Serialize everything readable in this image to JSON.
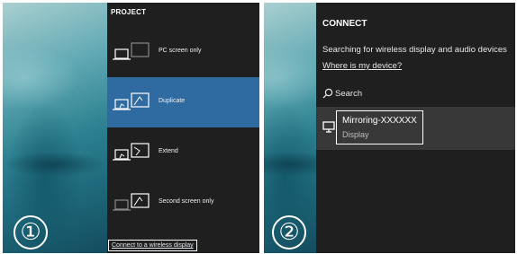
{
  "step1": {
    "number": "①",
    "title": "PROJECT",
    "items": [
      {
        "label": "PC screen only",
        "selected": false
      },
      {
        "label": "Duplicate",
        "selected": true
      },
      {
        "label": "Extend",
        "selected": false
      },
      {
        "label": "Second screen only",
        "selected": false
      }
    ],
    "wireless_link": "Connect to a wireless display"
  },
  "step2": {
    "number": "②",
    "title": "CONNECT",
    "searching": "Searching for wireless display and audio devices",
    "where_link": "Where is my device?",
    "search_label": "Search",
    "device": {
      "name": "Mirroring-XXXXXX",
      "type": "Display"
    }
  },
  "colors": {
    "panel_bg": "#1f1f1f",
    "selected_bg": "#2f6aa1",
    "device_row_bg": "#383838",
    "text": "#ffffff"
  }
}
